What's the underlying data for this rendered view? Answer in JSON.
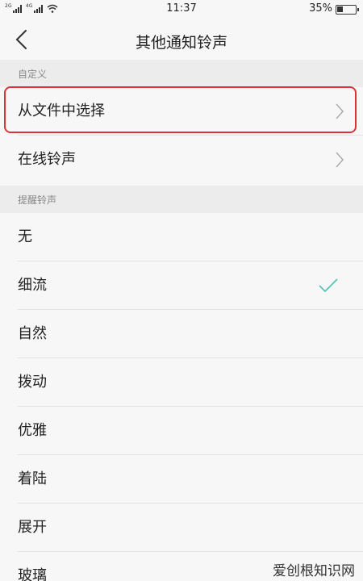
{
  "status_bar": {
    "network_left": "2G",
    "network_right": "4G",
    "time": "11:37",
    "battery": "35%",
    "battery_level": 0.35
  },
  "header": {
    "title": "其他通知铃声"
  },
  "custom_section": {
    "label": "自定义",
    "items": [
      {
        "label": "从文件中选择"
      },
      {
        "label": "在线铃声"
      }
    ]
  },
  "ringtone_section": {
    "label": "提醒铃声",
    "items": [
      {
        "label": "无"
      },
      {
        "label": "细流",
        "selected": true
      },
      {
        "label": "自然"
      },
      {
        "label": "拨动"
      },
      {
        "label": "优雅"
      },
      {
        "label": "着陆"
      },
      {
        "label": "展开"
      },
      {
        "label": "玻璃"
      }
    ]
  },
  "watermark": "爱创根知识网",
  "colors": {
    "check": "#4dc4b0",
    "highlight": "#d9323c"
  }
}
